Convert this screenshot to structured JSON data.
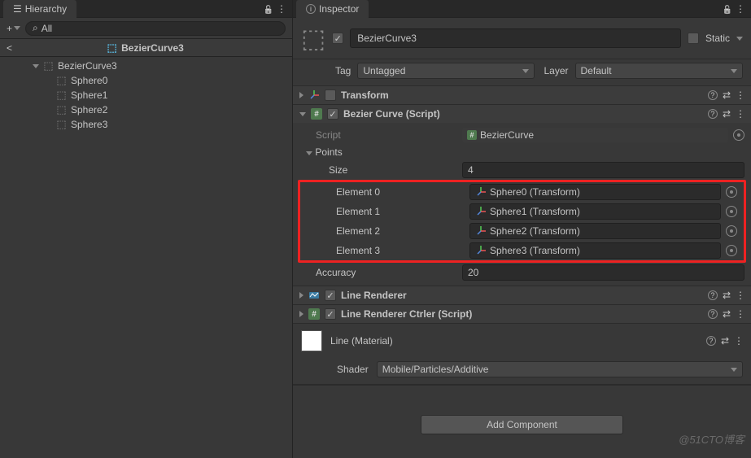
{
  "hierarchy": {
    "tab_title": "Hierarchy",
    "search_placeholder": "All",
    "scene_name": "BezierCurve3",
    "root": {
      "name": "BezierCurve3",
      "children": [
        "Sphere0",
        "Sphere1",
        "Sphere2",
        "Sphere3"
      ]
    }
  },
  "inspector": {
    "tab_title": "Inspector",
    "object_name": "BezierCurve3",
    "object_active": true,
    "static_label": "Static",
    "static_checked": false,
    "tag_label": "Tag",
    "tag_value": "Untagged",
    "layer_label": "Layer",
    "layer_value": "Default",
    "components": {
      "transform": {
        "title": "Transform",
        "expanded": false
      },
      "bezier_curve": {
        "title": "Bezier Curve (Script)",
        "expanded": true,
        "checked": true,
        "script_label": "Script",
        "script_value": "BezierCurve",
        "points_label": "Points",
        "size_label": "Size",
        "size_value": "4",
        "elements": [
          {
            "label": "Element 0",
            "value": "Sphere0 (Transform)"
          },
          {
            "label": "Element 1",
            "value": "Sphere1 (Transform)"
          },
          {
            "label": "Element 2",
            "value": "Sphere2 (Transform)"
          },
          {
            "label": "Element 3",
            "value": "Sphere3 (Transform)"
          }
        ],
        "accuracy_label": "Accuracy",
        "accuracy_value": "20"
      },
      "line_renderer": {
        "title": "Line Renderer",
        "expanded": false,
        "checked": true
      },
      "line_renderer_ctrler": {
        "title": "Line Renderer Ctrler (Script)",
        "expanded": false,
        "checked": true
      },
      "material": {
        "title": "Line (Material)",
        "shader_label": "Shader",
        "shader_value": "Mobile/Particles/Additive"
      }
    },
    "add_component_label": "Add Component"
  },
  "watermark": "@51CTO博客"
}
